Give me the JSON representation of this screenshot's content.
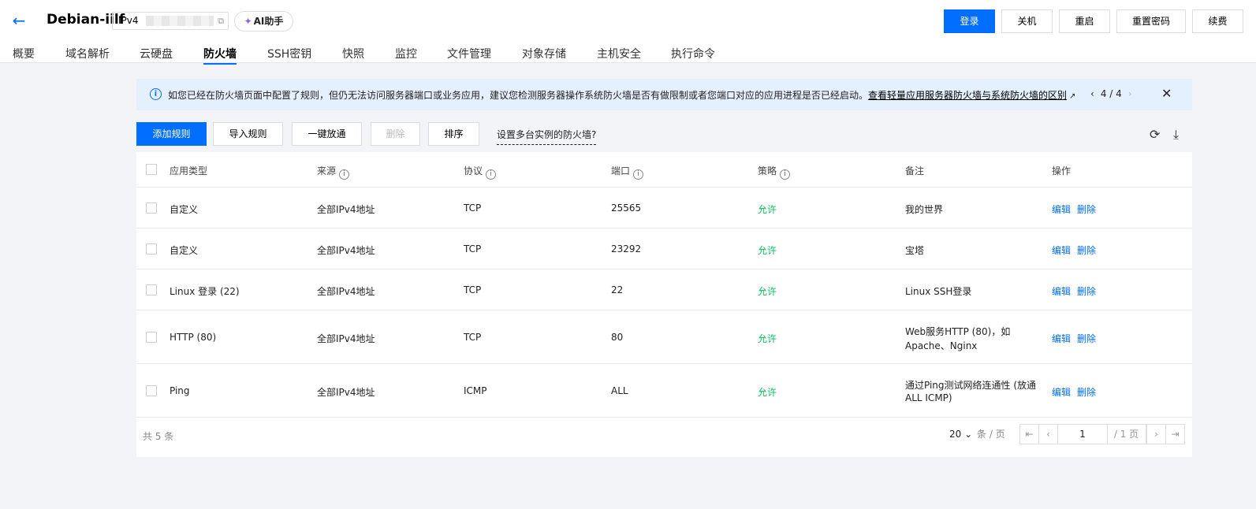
{
  "header": {
    "instance_name": "Debian-iilf",
    "ip_label": "IPv4",
    "ai_label": "AI助手",
    "actions": [
      "登录",
      "关机",
      "重启",
      "重置密码",
      "续费"
    ]
  },
  "tabs": [
    "概要",
    "域名解析",
    "云硬盘",
    "防火墙",
    "SSH密钥",
    "快照",
    "监控",
    "文件管理",
    "对象存储",
    "主机安全",
    "执行命令"
  ],
  "active_tab": "防火墙",
  "notice": {
    "text": "如您已经在防火墙页面中配置了规则，但仍无法访问服务器端口或业务应用，建议您检测服务器操作系统防火墙是否有做限制或者您端口对应的应用进程是否已经启动。",
    "link": "查看轻量应用服务器防火墙与系统防火墙的区别",
    "page": "4 / 4"
  },
  "toolbar": {
    "add": "添加规则",
    "import": "导入规则",
    "allow_all": "一键放通",
    "delete": "删除",
    "sort": "排序",
    "multi": "设置多台实例的防火墙?"
  },
  "table": {
    "headers": [
      "应用类型",
      "来源",
      "协议",
      "端口",
      "策略",
      "备注",
      "操作"
    ],
    "rows": [
      {
        "type": "自定义",
        "source": "全部IPv4地址",
        "protocol": "TCP",
        "port": "25565",
        "policy": "允许",
        "note": "我的世界",
        "note2": "",
        "edit": "编辑",
        "del": "删除"
      },
      {
        "type": "自定义",
        "source": "全部IPv4地址",
        "protocol": "TCP",
        "port": "23292",
        "policy": "允许",
        "note": "宝塔",
        "note2": "",
        "edit": "编辑",
        "del": "删除"
      },
      {
        "type": "Linux 登录 (22)",
        "source": "全部IPv4地址",
        "protocol": "TCP",
        "port": "22",
        "policy": "允许",
        "note": "Linux SSH登录",
        "note2": "",
        "edit": "编辑",
        "del": "删除"
      },
      {
        "type": "HTTP (80)",
        "source": "全部IPv4地址",
        "protocol": "TCP",
        "port": "80",
        "policy": "允许",
        "note": "Web服务HTTP (80)，如",
        "note2": "Apache、Nginx",
        "edit": "编辑",
        "del": "删除"
      },
      {
        "type": "Ping",
        "source": "全部IPv4地址",
        "protocol": "ICMP",
        "port": "ALL",
        "policy": "允许",
        "note": "通过Ping测试网络连通性 (放通",
        "note2": "ALL ICMP)",
        "edit": "编辑",
        "del": "删除"
      }
    ]
  },
  "pagination": {
    "total": "共 5 条",
    "page_size": "20",
    "per_page": "条 / 页",
    "current": "1",
    "pages": "/ 1 页"
  },
  "colors": {
    "primary": "#006eff",
    "allow": "#0abf5b",
    "notice_bg": "#e5f0ff"
  }
}
